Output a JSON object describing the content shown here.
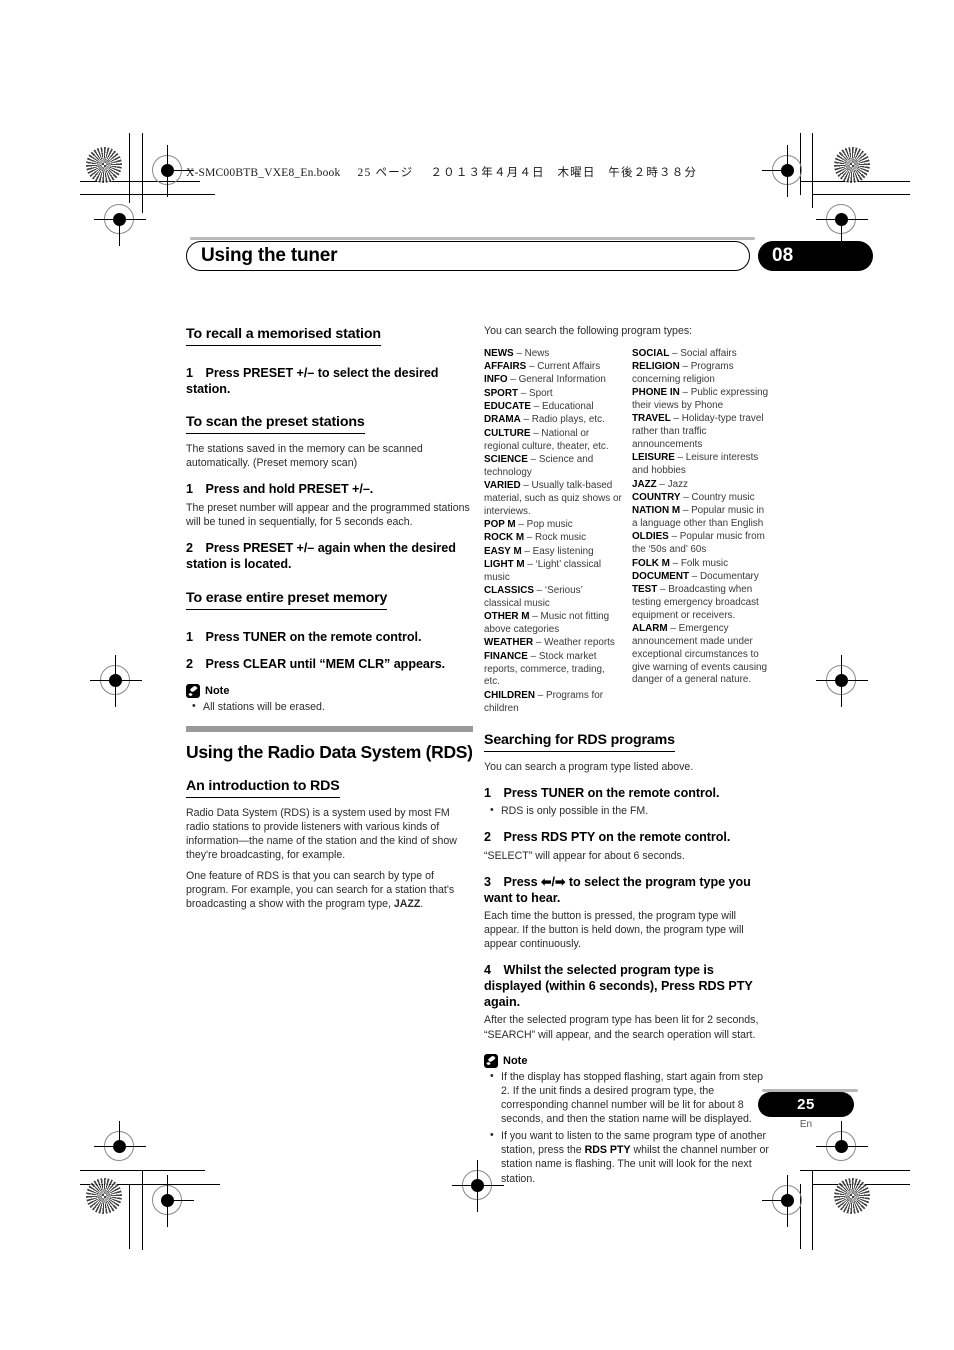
{
  "print_header": {
    "bookfile": "X-SMC00BTB_VXE8_En.book",
    "page_label": "25 ページ",
    "date": "２０１３年４月４日　木曜日　午後２時３８分"
  },
  "chapter": {
    "title": "Using the tuner",
    "number": "08"
  },
  "left_column": {
    "s1": {
      "heading": "To recall a memorised station",
      "step1": "1 Press PRESET +/– to select the desired station."
    },
    "s2": {
      "heading": "To scan the preset stations",
      "intro": "The stations saved in the memory can be scanned automatically. (Preset memory scan)",
      "step1": "1 Press and hold PRESET +/–.",
      "step1_body": "The preset number will appear and the programmed stations will be tuned in sequentially, for 5 seconds each.",
      "step2": "2 Press PRESET +/– again when the desired station is located."
    },
    "s3": {
      "heading": "To erase entire preset memory",
      "step1": "1 Press TUNER on the remote control.",
      "step2": "2 Press CLEAR until “MEM CLR” appears.",
      "note_label": "Note",
      "note_items": [
        "All stations will be erased."
      ]
    },
    "s4": {
      "heading": "Using the Radio Data System (RDS)",
      "sub_heading": "An introduction to RDS",
      "p1": "Radio Data System (RDS) is a system used by most FM radio stations to provide listeners with various kinds of information—the name of the station and the kind of show they're broadcasting, for example.",
      "p2_a": "One feature of RDS is that you can search by type of program. For example, you can search for a station that's broadcasting a show with the program type, ",
      "p2_bold": "JAZZ",
      "p2_b": "."
    }
  },
  "right_column": {
    "pty_intro": "You can search the following program types:",
    "pty_column_1": [
      {
        "code": "NEWS",
        "desc": "– News"
      },
      {
        "code": "AFFAIRS",
        "desc": "– Current Affairs"
      },
      {
        "code": "INFO",
        "desc": "– General Information"
      },
      {
        "code": "SPORT",
        "desc": "– Sport"
      },
      {
        "code": "EDUCATE",
        "desc": "– Educational"
      },
      {
        "code": "DRAMA",
        "desc": "– Radio plays, etc."
      },
      {
        "code": "CULTURE",
        "desc": "– National or regional culture, theater, etc."
      },
      {
        "code": "SCIENCE",
        "desc": "– Science and technology"
      },
      {
        "code": "VARIED",
        "desc": "– Usually talk-based material, such as quiz shows or interviews."
      },
      {
        "code": "POP M",
        "desc": "– Pop music"
      },
      {
        "code": "ROCK M",
        "desc": "– Rock music"
      },
      {
        "code": "EASY M",
        "desc": "– Easy listening"
      },
      {
        "code": "LIGHT M",
        "desc": "– ‘Light’ classical music"
      },
      {
        "code": "CLASSICS",
        "desc": "– ‘Serious’ classical music"
      },
      {
        "code": "OTHER M",
        "desc": "– Music not fitting above categories"
      },
      {
        "code": "WEATHER",
        "desc": "– Weather reports"
      },
      {
        "code": "FINANCE",
        "desc": "– Stock market reports, commerce, trading, etc."
      },
      {
        "code": "CHILDREN",
        "desc": "– Programs for children"
      }
    ],
    "pty_column_2": [
      {
        "code": "SOCIAL",
        "desc": "– Social affairs"
      },
      {
        "code": "RELIGION",
        "desc": "– Programs concerning religion"
      },
      {
        "code": "PHONE IN",
        "desc": "– Public expressing their views by Phone"
      },
      {
        "code": "TRAVEL",
        "desc": "– Holiday-type travel rather than traffic announcements"
      },
      {
        "code": "LEISURE",
        "desc": "– Leisure interests and hobbies"
      },
      {
        "code": "JAZZ",
        "desc": "– Jazz"
      },
      {
        "code": "COUNTRY",
        "desc": "– Country music"
      },
      {
        "code": "NATION M",
        "desc": "– Popular music in a language other than English"
      },
      {
        "code": "OLDIES",
        "desc": "– Popular music from the ‘50s and’ 60s"
      },
      {
        "code": "FOLK M",
        "desc": "– Folk music"
      },
      {
        "code": "DOCUMENT",
        "desc": "– Documentary"
      },
      {
        "code": "TEST",
        "desc": "– Broadcasting when testing emergency broadcast equipment or receivers."
      },
      {
        "code": "ALARM",
        "desc": "– Emergency announcement made under exceptional circumstances to give warning of events causing danger of a general nature."
      }
    ],
    "search": {
      "heading": "Searching for RDS programs",
      "intro": "You can search a program type listed above.",
      "step1": "1 Press TUNER on the remote control.",
      "step1_bullets": [
        "RDS is only possible in the FM."
      ],
      "step2": "2 Press RDS PTY on the remote control.",
      "step2_body": "“SELECT” will appear for about 6 seconds.",
      "step3": "3 Press ⬅/➡ to select the program type you want to hear.",
      "step3_body": "Each time the button is pressed, the program type will appear. If the button is held down, the program type will appear continuously.",
      "step4": "4 Whilst the selected program type is displayed (within 6 seconds), Press RDS PTY again.",
      "step4_body": "After the selected program type has been lit for 2 seconds, “SEARCH” will appear, and the search operation will start.",
      "note_label": "Note",
      "note_1": "If the display has stopped flashing, start again from step 2. If the unit finds a desired program type, the corresponding channel number will be lit for about 8 seconds, and then the station name will be displayed.",
      "note_2_a": "If you want to listen to the same program type of another station, press the ",
      "note_2_bold": "RDS PTY",
      "note_2_b": " whilst the channel number or station name is flashing. The unit will look for the next station."
    }
  },
  "footer": {
    "page_number": "25",
    "language": "En"
  }
}
